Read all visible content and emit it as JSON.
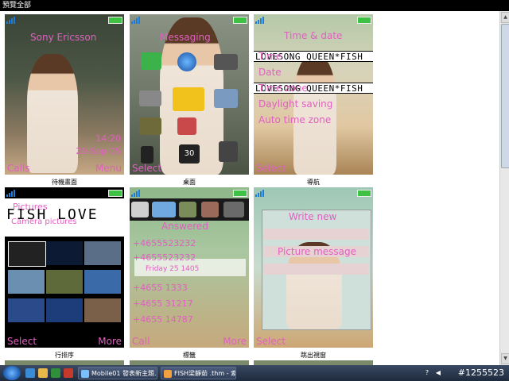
{
  "window": {
    "title": "預覽全部"
  },
  "tiles": [
    {
      "caption": "待機畫面",
      "left_soft": "Calls",
      "right_soft": "Menu",
      "lines": [
        "Sony Ericsson",
        "14:20",
        "29-Sep-05"
      ]
    },
    {
      "caption": "桌面",
      "left_soft": "Select",
      "right_soft": "",
      "lines": [
        "Messaging"
      ]
    },
    {
      "caption": "導航",
      "left_soft": "Select",
      "right_soft": "",
      "lines": [
        "Time & date",
        "Time",
        "Date",
        "Time zone",
        "Daylight saving",
        "Auto time zone"
      ],
      "band_text": "LOVESONG QUEEN*FISH"
    },
    {
      "caption": "行排序",
      "left_soft": "Select",
      "right_soft": "More",
      "lines": [
        "Pictures",
        "Camera pictures"
      ],
      "band_text": "FISH LOVE"
    },
    {
      "caption": "標籤",
      "left_soft": "Call",
      "right_soft": "More",
      "lines": [
        "Answered",
        "+4655523232",
        "+4655523232",
        "Friday 25 1405",
        "+4655 1333",
        "+4655 31217",
        "+4655 14787"
      ]
    },
    {
      "caption": "跳出視窗",
      "left_soft": "Select",
      "right_soft": "",
      "lines": [
        "Write new",
        "Picture message"
      ]
    }
  ],
  "taskbar": {
    "tasks": [
      {
        "label": "Mobile01 發表新主題..."
      },
      {
        "label": "FISH梁靜茹 .thm - 索..."
      }
    ],
    "tray_icons": [
      "?",
      "◀"
    ],
    "clock": "#1255523"
  },
  "colors": {
    "soft_key": "#e060c0",
    "titlebar": "#000000",
    "taskbar": "#1e2a3d"
  }
}
